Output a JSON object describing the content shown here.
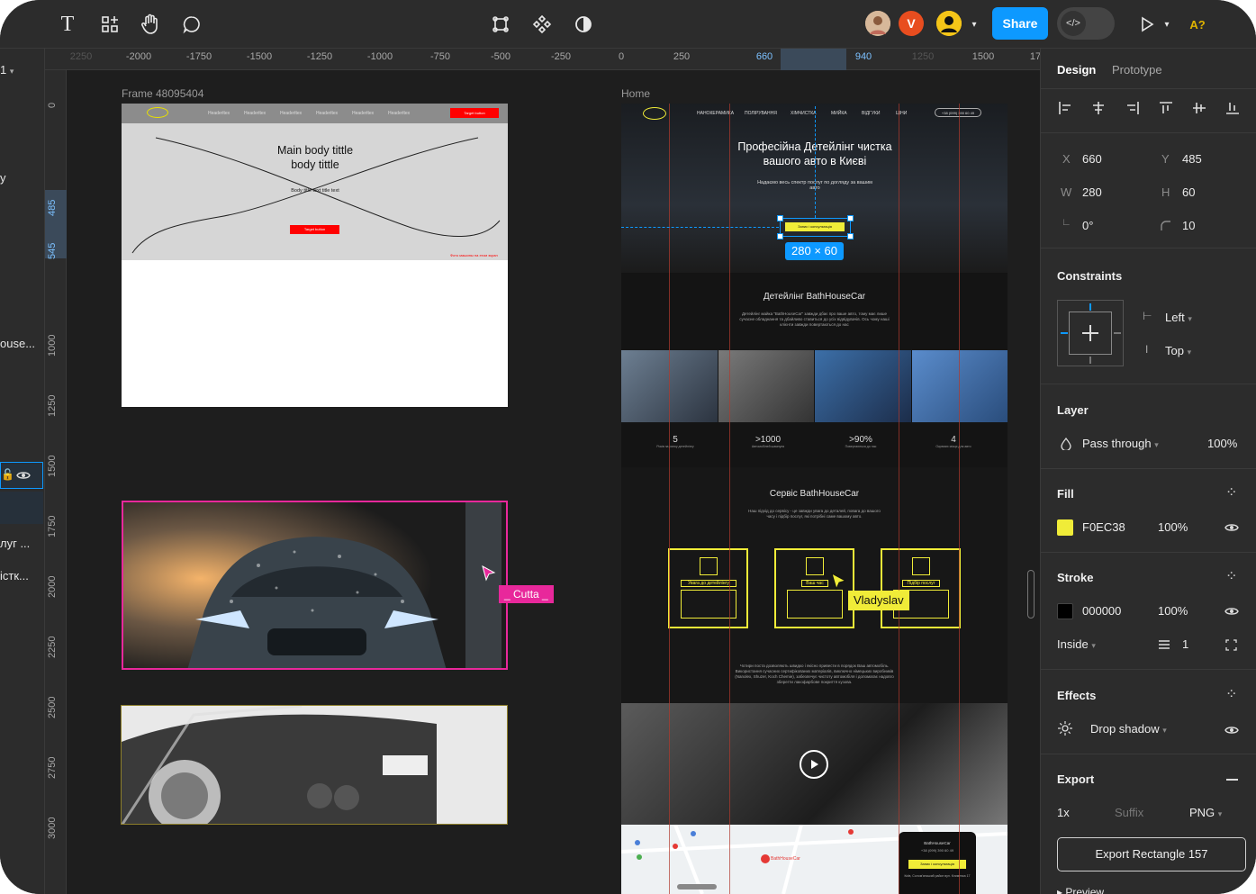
{
  "toolbar": {
    "avatar_initial": "V",
    "share_label": "Share",
    "code_label": "</>",
    "missing_fonts": "A?"
  },
  "ruler_top": [
    "2250",
    "-2000",
    "-1750",
    "-1500",
    "-1250",
    "-1000",
    "-750",
    "-500",
    "-250",
    "0",
    "250",
    "660",
    "940",
    "1250",
    "1500",
    "17"
  ],
  "ruler_left": [
    "0",
    "485",
    "545",
    "1000",
    "1250",
    "1500",
    "1750",
    "2000",
    "2250",
    "2500",
    "2750",
    "3000"
  ],
  "layers": {
    "page_label": "1",
    "items": [
      "y",
      "ouse...",
      "луг ...",
      "істк..."
    ]
  },
  "canvas": {
    "frame1_label": "Frame 48095404",
    "frame2_label": "Home",
    "wire": {
      "nav_items": [
        "Headerltex",
        "Headerltex",
        "Headerltex",
        "Headerltex",
        "Headerltex",
        "Headerltex"
      ],
      "nav_button": "Target button",
      "title": "Main body tittle body tittle",
      "body": "Body title text title text",
      "button": "Target button",
      "footnote": "Фото машины на этом экран"
    },
    "cursor_cutta": "Cutta",
    "cursor_vladyslav": "Vladyslav",
    "size_badge": "280 × 60",
    "home": {
      "nav": [
        "НАНОКЕРАМИКА",
        "ПОЛІРУВАННЯ",
        "ХІМЧИСТКА",
        "МИЙКА",
        "ВІДГУКИ",
        "ЦІНИ"
      ],
      "phone": "+38 (099) 390 60 49",
      "hero_title": "Професійна Детейлінг чистка вашого авто в Києві",
      "hero_sub": "Надаємо весь спектр послуг по догляду за вашим авто",
      "hero_btn": "Запис і консультація",
      "about_title": "Детейлінг BathHouseCar",
      "about_text": "Детейлінг майка \"BathHouseCar\" завжди дбає про ваше авто, тому має лише сучасне обладнання та дбайливо ставиться до усіх відвідувачів. Ось чому наші клієнти завжди повертаються до нас",
      "stats": [
        {
          "value": "5",
          "label": "Років на ринку детейлінгу"
        },
        {
          "value": ">1000",
          "label": "Автомобілей шампуня"
        },
        {
          "value": ">90%",
          "label": "Повертаються до нас"
        },
        {
          "value": "4",
          "label": "Окремих місця для авто"
        }
      ],
      "service_title": "Сервіс BathHouseCar",
      "service_sub": "Наш підхід до сервісу - це завжди увага до деталей, повага до вашого часу і підбір послуг, які потрібні саме вашому авто.",
      "cards": [
        "Увага до детейлінгу",
        "Ваш час",
        "Підбір послуг"
      ],
      "service_text": "Чотири поста дозволяють швидко і якісно привести в порядок Ваш автомобіль. Використання сучасних сертифікованих матеріалів, виключно німецьких виробників (Nanolex, Shuzer, Koch Chemie), забезпечує чистоту автомобіля і допомагає надовго зберегти лакофарбове покриття кузова.",
      "map_label": "BathHouseCar",
      "map_card_title": "BathHouseCar",
      "map_card_phone": "+38 (099) 390 60 49",
      "map_card_btn": "Запис і консультація",
      "map_card_addr": "Київ, Солом'янський район вул. Клименка 17"
    }
  },
  "panel": {
    "tab_design": "Design",
    "tab_prototype": "Prototype",
    "x_label": "X",
    "x_value": "660",
    "y_label": "Y",
    "y_value": "485",
    "w_label": "W",
    "w_value": "280",
    "h_label": "H",
    "h_value": "60",
    "rotation": "0°",
    "radius": "10",
    "constraints_title": "Constraints",
    "constraint_h": "Left",
    "constraint_v": "Top",
    "layer_title": "Layer",
    "blend": "Pass through",
    "layer_opacity": "100%",
    "fill_title": "Fill",
    "fill_hex": "F0EC38",
    "fill_color": "#F0EC38",
    "fill_opacity": "100%",
    "stroke_title": "Stroke",
    "stroke_hex": "000000",
    "stroke_opacity": "100%",
    "stroke_position": "Inside",
    "stroke_weight": "1",
    "effects_title": "Effects",
    "effect_name": "Drop shadow",
    "export_title": "Export",
    "export_scale": "1x",
    "export_suffix": "Suffix",
    "export_format": "PNG",
    "export_button": "Export Rectangle 157",
    "preview": "Preview"
  }
}
